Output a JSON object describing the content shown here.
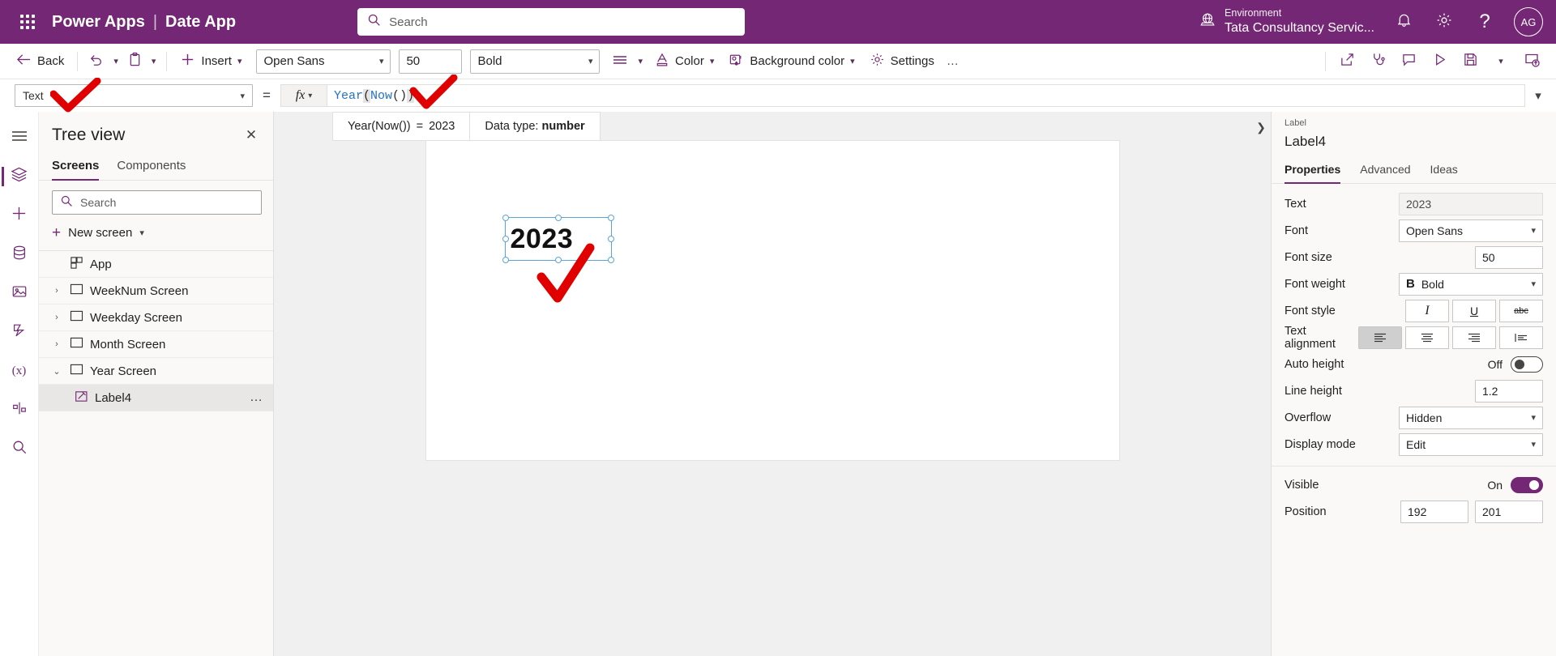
{
  "topbar": {
    "waffle_label": "app-launcher",
    "brand": "Power Apps",
    "separator": "|",
    "app_name": "Date App",
    "search_placeholder": "Search",
    "environment_label": "Environment",
    "environment_name": "Tata Consultancy Servic...",
    "avatar_initials": "AG",
    "brand_color": "#742774"
  },
  "cmdbar": {
    "back": "Back",
    "insert": "Insert",
    "font": "Open Sans",
    "font_size": "50",
    "font_weight": "Bold",
    "color": "Color",
    "background_color": "Background color",
    "settings": "Settings",
    "overflow": "…"
  },
  "formulabar": {
    "property": "Text",
    "equals": "=",
    "fx": "fx",
    "formula_tokens": [
      {
        "text": "Year",
        "kind": "fn"
      },
      {
        "text": "(",
        "kind": "paren"
      },
      {
        "text": "Now",
        "kind": "fn"
      },
      {
        "text": "(",
        "kind": "paren2"
      },
      {
        "text": ")",
        "kind": "paren2"
      },
      {
        "text": ")",
        "kind": "paren"
      }
    ],
    "result_expression": "Year(Now())",
    "result_equals": "=",
    "result_value": "2023",
    "datatype_label": "Data type:",
    "datatype_value": "number"
  },
  "treeview": {
    "title": "Tree view",
    "tabs": [
      {
        "label": "Screens",
        "active": true
      },
      {
        "label": "Components",
        "active": false
      }
    ],
    "search_placeholder": "Search",
    "new_screen": "New screen",
    "items": [
      {
        "label": "App",
        "icon": "app-icon",
        "caret": false,
        "indent": false,
        "selected": false
      },
      {
        "label": "WeekNum Screen",
        "icon": "screen-icon",
        "caret": "›",
        "indent": false,
        "selected": false
      },
      {
        "label": "Weekday Screen",
        "icon": "screen-icon",
        "caret": "›",
        "indent": false,
        "selected": false
      },
      {
        "label": "Month Screen",
        "icon": "screen-icon",
        "caret": "›",
        "indent": false,
        "selected": false
      },
      {
        "label": "Year Screen",
        "icon": "screen-icon",
        "caret": "⌄",
        "indent": false,
        "selected": false
      },
      {
        "label": "Label4",
        "icon": "label-icon",
        "caret": false,
        "indent": true,
        "selected": true,
        "more": "…"
      }
    ]
  },
  "canvas": {
    "label_text": "2023"
  },
  "properties": {
    "breadcrumb": "Label",
    "control_name": "Label4",
    "tabs": [
      {
        "label": "Properties",
        "active": true
      },
      {
        "label": "Advanced",
        "active": false
      },
      {
        "label": "Ideas",
        "active": false
      }
    ],
    "rows": {
      "text_label": "Text",
      "text_value": "2023",
      "font_label": "Font",
      "font_value": "Open Sans",
      "font_size_label": "Font size",
      "font_size_value": "50",
      "font_weight_label": "Font weight",
      "font_weight_value": "Bold",
      "font_weight_glyph": "B",
      "font_style_label": "Font style",
      "font_style_italic": "I",
      "font_style_underline": "U",
      "font_style_strike": "abc",
      "text_alignment_label": "Text alignment",
      "auto_height_label": "Auto height",
      "auto_height_state": "Off",
      "line_height_label": "Line height",
      "line_height_value": "1.2",
      "overflow_label": "Overflow",
      "overflow_value": "Hidden",
      "display_mode_label": "Display mode",
      "display_mode_value": "Edit",
      "visible_label": "Visible",
      "visible_state": "On",
      "position_label": "Position",
      "position_x": "192",
      "position_y": "201"
    }
  }
}
